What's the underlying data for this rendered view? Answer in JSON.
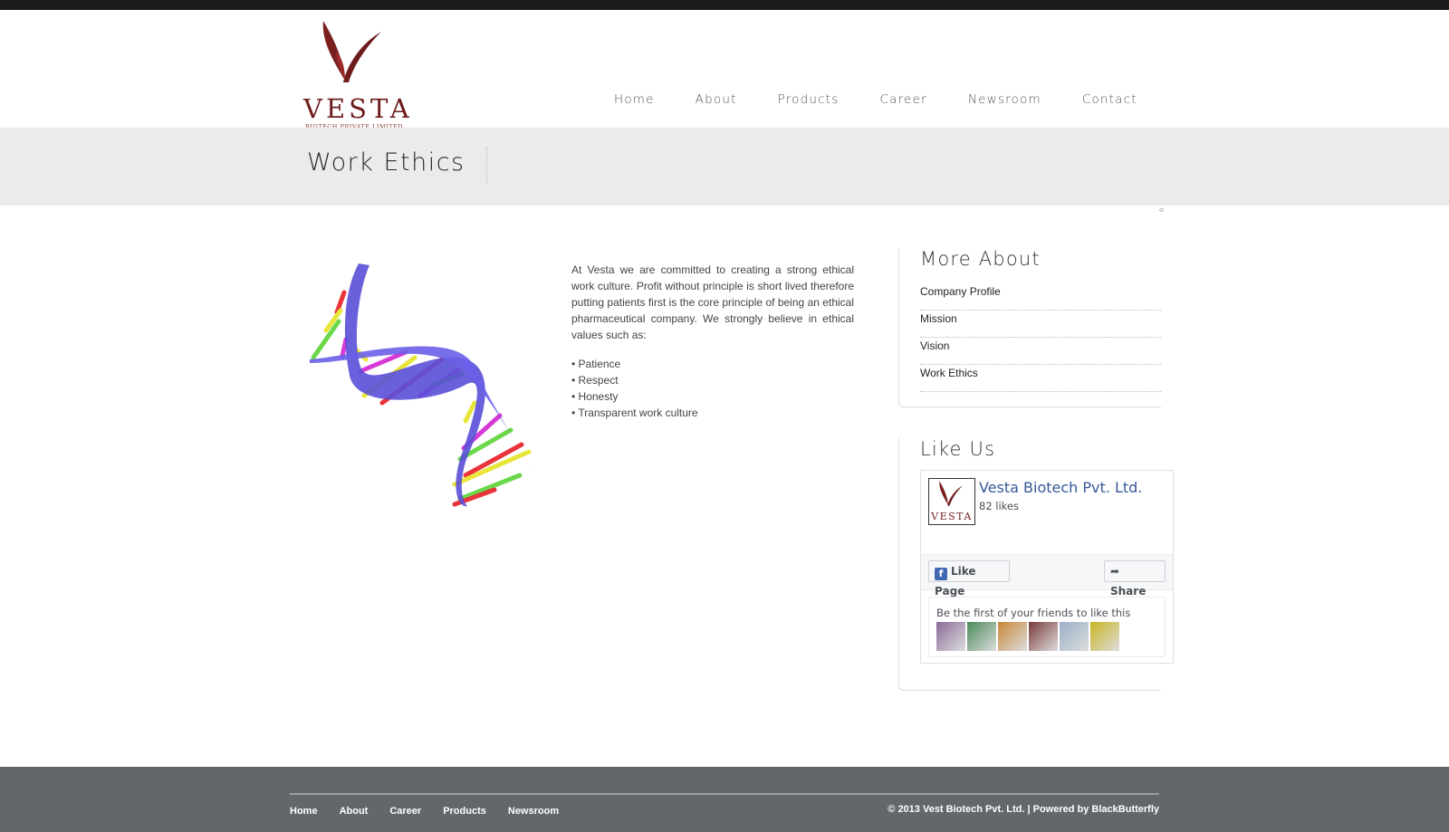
{
  "header": {
    "logo_word": "VESTA",
    "logo_sub": "BIOTECH PRIVATE LIMITED",
    "nav": [
      "Home",
      "About",
      "Products",
      "Career",
      "Newsroom",
      "Contact"
    ]
  },
  "banner": {
    "title": "Work Ethics"
  },
  "content": {
    "paragraph": "At Vesta we are committed to creating a strong ethical work culture. Profit without principle is short lived therefore putting patients first is the core principle of being an ethical pharmaceutical company. We strongly believe in ethical values such as:",
    "values": [
      "• Patience",
      "• Respect",
      "• Honesty",
      "• Transparent work culture"
    ]
  },
  "more_about": {
    "title": "More About",
    "links": [
      "Company Profile",
      "Mission",
      "Vision",
      "Work Ethics"
    ]
  },
  "like_us": {
    "title": "Like Us",
    "fb_page_name": "Vesta Biotech Pvt. Ltd.",
    "fb_likes": "82 likes",
    "fb_logo_word": "VESTA",
    "like_button": "Like Page",
    "share_button": "Share",
    "friends_text": "Be the first of your friends to like this",
    "friend_face_colors": [
      "#8a6a9a",
      "#4a8a5a",
      "#c8873a",
      "#7a3a3a",
      "#9ab0c8",
      "#c8b420"
    ]
  },
  "footer": {
    "nav": [
      "Home",
      "About",
      "Career",
      "Products",
      "Newsroom"
    ],
    "copyright": "© 2013 Vest Biotech Pvt. Ltd. | Powered by BlackButterfly"
  },
  "colors": {
    "brand": "#6e1b1b",
    "footer_bg": "#63666a",
    "banner_bg": "#ebebeb",
    "fb_link": "#365899"
  }
}
